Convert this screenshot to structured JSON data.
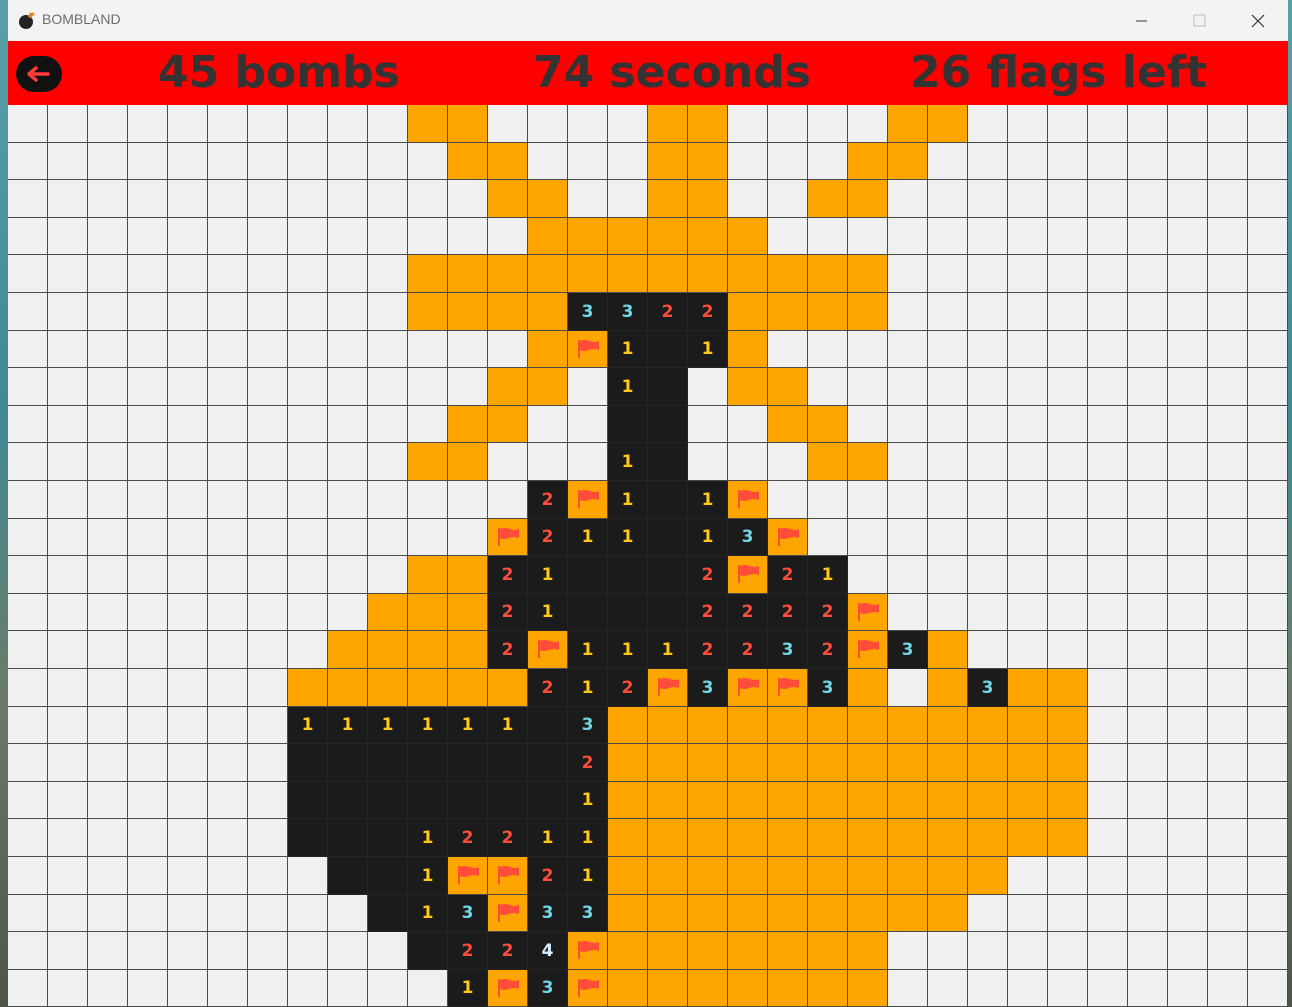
{
  "window": {
    "title": "BOMBLAND"
  },
  "header": {
    "bombs_label": "45 bombs",
    "seconds_label": "74 seconds",
    "flags_label": "26 flags left"
  },
  "colors": {
    "header_bg": "#ff0000",
    "hidden": "#f0f0f0",
    "highlighted": "#ffa500",
    "revealed": "#1b1b1b",
    "num1": "#ffc81a",
    "num2": "#ff4d3a",
    "num3": "#6fd6e6",
    "num4": "#d6f0ff"
  },
  "board": {
    "legend": ". = hidden, o = highlighted hidden, r = revealed empty, 1-4 = revealed number, f = flag",
    "rows": [
      "..........oo....oo....oo..........",
      "...........oo...oo...oo...........",
      "............oo..oo..oo............",
      ".............oooooo...............",
      "..........oooooooooooo............",
      "..........oooo3322oooo............",
      ".............of1r1o...............",
      "............oo.1r.oo..............",
      "...........oo..rr..oo.............",
      "..........oo...1r...oo............",
      ".............2f1r1f...............",
      "............f211r13f..............",
      "..........oo21rrr2f21.............",
      ".........ooo21rrr2222f............",
      "........oooo2f1112232f3o..........",
      ".......oooooo212f3ff3o.o3oo........",
      ".......111111r3oooooooooooo.......",
      ".......rrrrrrr2oooooooooooo.......",
      ".......rrrrrrr1oooooooooooo.......",
      ".......rrr12211oooooooooooo.......",
      "........rr1ff21oooooooooo.........",
      ".........r13f33ooooooooo..........",
      "..........r224fooooooo............",
      "...........1f3fooooooo............"
    ]
  }
}
